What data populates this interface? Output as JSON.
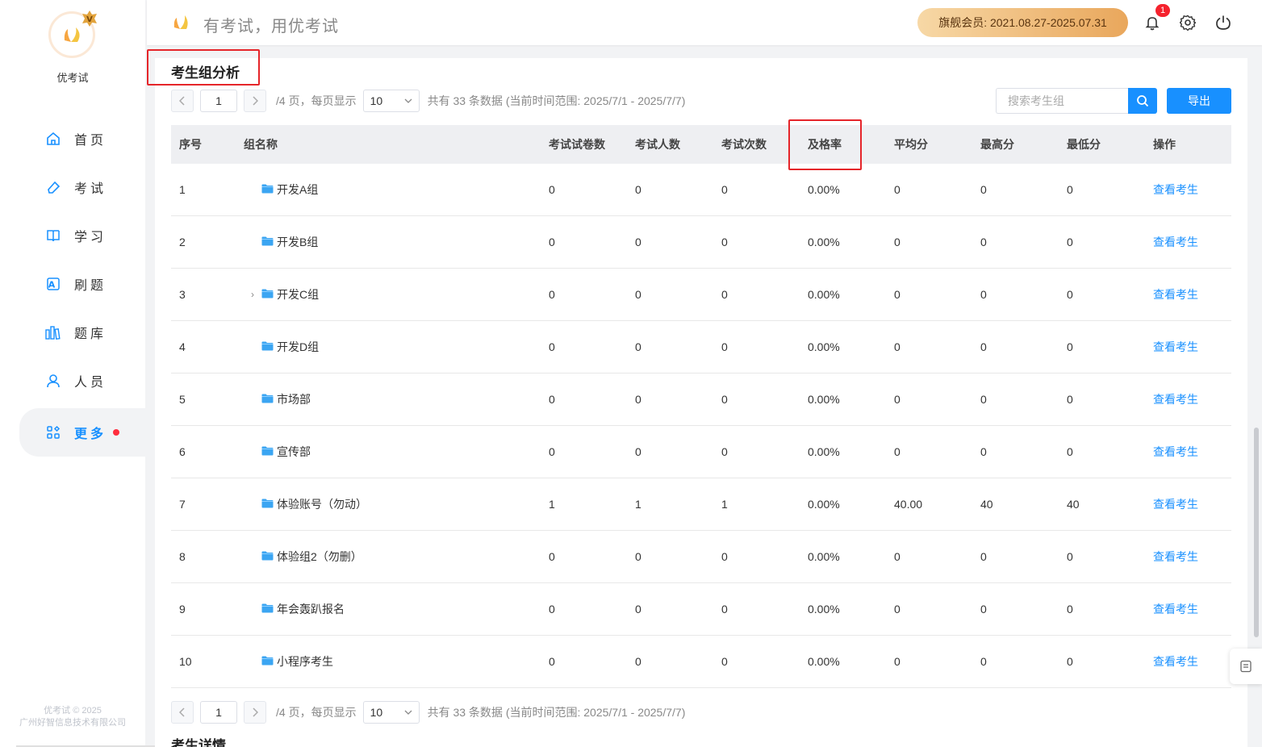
{
  "app": {
    "name": "优考试",
    "slogan": "有考试，用优考试"
  },
  "sidebar": {
    "items": [
      {
        "label": "首页",
        "icon": "home-icon"
      },
      {
        "label": "考试",
        "icon": "eraser-icon"
      },
      {
        "label": "学习",
        "icon": "book-icon"
      },
      {
        "label": "刷题",
        "icon": "letter-a-icon"
      },
      {
        "label": "题库",
        "icon": "library-icon"
      },
      {
        "label": "人员",
        "icon": "user-icon"
      },
      {
        "label": "更多",
        "icon": "apps-icon",
        "active": true
      }
    ],
    "footer_line1": "优考试 © 2025",
    "footer_line2": "广州好智信息技术有限公司"
  },
  "header": {
    "vip_label": "旗舰会员: 2021.08.27-2025.07.31",
    "notification_count": "1"
  },
  "section": {
    "title": "考生组分析",
    "detail_title": "考生详情"
  },
  "pager": {
    "current_page": "1",
    "pages_text": "/4 页，每页显示",
    "page_size": "10",
    "total_text": "共有 33 条数据 (当前时间范围: 2025/7/1 - 2025/7/7)"
  },
  "search": {
    "placeholder": "搜索考生组"
  },
  "export_label": "导出",
  "table": {
    "headers": [
      "序号",
      "组名称",
      "考试试卷数",
      "考试人数",
      "考试次数",
      "及格率",
      "平均分",
      "最高分",
      "最低分",
      "操作"
    ],
    "rows": [
      {
        "index": "1",
        "name": "开发A组",
        "papers": "0",
        "people": "0",
        "times": "0",
        "pass_rate": "0.00%",
        "avg": "0",
        "max": "0",
        "min": "0",
        "action": "查看考生",
        "expandable": false
      },
      {
        "index": "2",
        "name": "开发B组",
        "papers": "0",
        "people": "0",
        "times": "0",
        "pass_rate": "0.00%",
        "avg": "0",
        "max": "0",
        "min": "0",
        "action": "查看考生",
        "expandable": false
      },
      {
        "index": "3",
        "name": "开发C组",
        "papers": "0",
        "people": "0",
        "times": "0",
        "pass_rate": "0.00%",
        "avg": "0",
        "max": "0",
        "min": "0",
        "action": "查看考生",
        "expandable": true
      },
      {
        "index": "4",
        "name": "开发D组",
        "papers": "0",
        "people": "0",
        "times": "0",
        "pass_rate": "0.00%",
        "avg": "0",
        "max": "0",
        "min": "0",
        "action": "查看考生",
        "expandable": false
      },
      {
        "index": "5",
        "name": "市场部",
        "papers": "0",
        "people": "0",
        "times": "0",
        "pass_rate": "0.00%",
        "avg": "0",
        "max": "0",
        "min": "0",
        "action": "查看考生",
        "expandable": false
      },
      {
        "index": "6",
        "name": "宣传部",
        "papers": "0",
        "people": "0",
        "times": "0",
        "pass_rate": "0.00%",
        "avg": "0",
        "max": "0",
        "min": "0",
        "action": "查看考生",
        "expandable": false
      },
      {
        "index": "7",
        "name": "体验账号（勿动）",
        "papers": "1",
        "people": "1",
        "times": "1",
        "pass_rate": "0.00%",
        "avg": "40.00",
        "max": "40",
        "min": "40",
        "action": "查看考生",
        "expandable": false
      },
      {
        "index": "8",
        "name": "体验组2（勿删）",
        "papers": "0",
        "people": "0",
        "times": "0",
        "pass_rate": "0.00%",
        "avg": "0",
        "max": "0",
        "min": "0",
        "action": "查看考生",
        "expandable": false
      },
      {
        "index": "9",
        "name": "年会轰趴报名",
        "papers": "0",
        "people": "0",
        "times": "0",
        "pass_rate": "0.00%",
        "avg": "0",
        "max": "0",
        "min": "0",
        "action": "查看考生",
        "expandable": false
      },
      {
        "index": "10",
        "name": "小程序考生",
        "papers": "0",
        "people": "0",
        "times": "0",
        "pass_rate": "0.00%",
        "avg": "0",
        "max": "0",
        "min": "0",
        "action": "查看考生",
        "expandable": false
      }
    ]
  },
  "colors": {
    "accent": "#1890ff",
    "highlight": "#e5252a",
    "vip_start": "#f7d8a6",
    "vip_end": "#e9a75c"
  }
}
